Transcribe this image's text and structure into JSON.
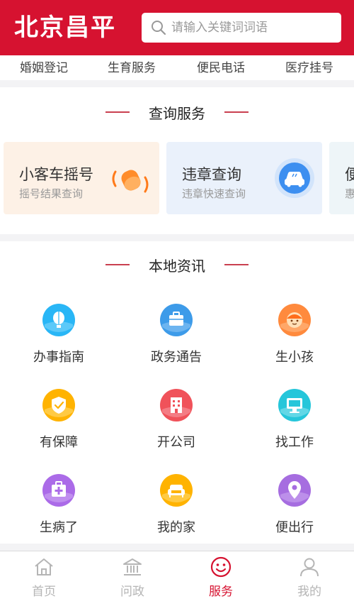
{
  "header": {
    "logo_text": "北京昌平",
    "search_placeholder": "请输入关键词词语"
  },
  "quick_nav": [
    "婚姻登记",
    "生育服务",
    "便民电话",
    "医疗挂号"
  ],
  "query_section": {
    "title": "查询服务",
    "cards": [
      {
        "title": "小客车摇号",
        "subtitle": "摇号结果查询",
        "icon": "car-lottery-icon"
      },
      {
        "title": "违章查询",
        "subtitle": "违章快速查询",
        "icon": "car-violation-icon"
      },
      {
        "title": "便",
        "subtitle": "惠",
        "icon": ""
      }
    ]
  },
  "news_section": {
    "title": "本地资讯",
    "items": [
      {
        "label": "办事指南",
        "icon": "balloon-icon",
        "color": "#29b6f6"
      },
      {
        "label": "政务通告",
        "icon": "briefcase-icon",
        "color": "#3d9be9"
      },
      {
        "label": "生小孩",
        "icon": "baby-face-icon",
        "color": "#ff8a3d"
      },
      {
        "label": "有保障",
        "icon": "shield-icon",
        "color": "#ffb300"
      },
      {
        "label": "开公司",
        "icon": "building-icon",
        "color": "#f0525a"
      },
      {
        "label": "找工作",
        "icon": "computer-icon",
        "color": "#26c6da"
      },
      {
        "label": "生病了",
        "icon": "first-aid-icon",
        "color": "#ab6be8"
      },
      {
        "label": "我的家",
        "icon": "sofa-icon",
        "color": "#ffb300"
      },
      {
        "label": "便出行",
        "icon": "location-pin-icon",
        "color": "#a66de0"
      }
    ]
  },
  "tabbar": {
    "items": [
      {
        "label": "首页",
        "icon": "home-icon",
        "active": false
      },
      {
        "label": "问政",
        "icon": "government-building-icon",
        "active": false
      },
      {
        "label": "服务",
        "icon": "smiley-icon",
        "active": true
      },
      {
        "label": "我的",
        "icon": "user-icon",
        "active": false
      }
    ]
  },
  "colors": {
    "brand_red": "#d61230",
    "tab_inactive": "#b5b5b5"
  }
}
